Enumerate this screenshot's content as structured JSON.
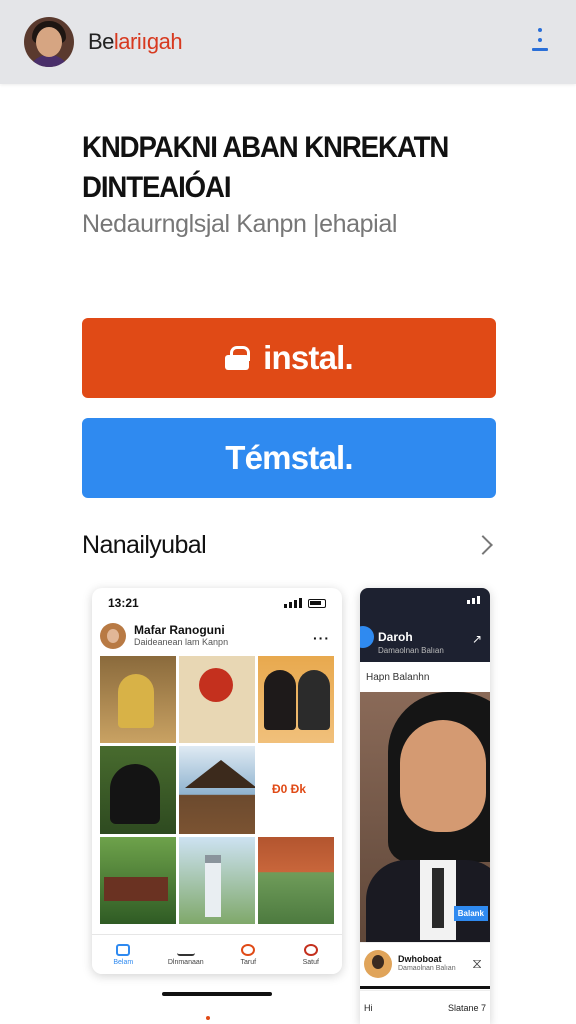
{
  "header": {
    "brand_a": "Be",
    "brand_b": "lariıgah"
  },
  "hero": {
    "title_line1": "KNDPAKNI ABAN KNREKATN",
    "title_line2": "DINTEAIÓAI",
    "subtitle": "Nedaurnglsjal Kanpn |ehapial"
  },
  "buttons": {
    "install": "instal.",
    "secondary": "Témstal."
  },
  "section": {
    "title": "Nanailyubal"
  },
  "phone1": {
    "time": "13:21",
    "profile_name": "Mafar Ranoguni",
    "profile_sub": "Daideanean lam Kanpn",
    "tile_tag": "Ð0 Ðk",
    "nav": [
      "Belam",
      "Dlnmanaan",
      "Taruf",
      "Satuf"
    ]
  },
  "phone2": {
    "title": "Daroh",
    "sub": "Damaolnan Balıan",
    "line": "Hapn Balanhn",
    "badge": "Balank",
    "foot_title": "Dwhoboat",
    "foot_sub": "Damaolnan Balıan",
    "bottom_left": "Hi",
    "bottom_right": "Slatane 7"
  },
  "colors": {
    "install": "#e04a16",
    "secondary": "#2f8af0",
    "brand_accent": "#d7391f"
  }
}
